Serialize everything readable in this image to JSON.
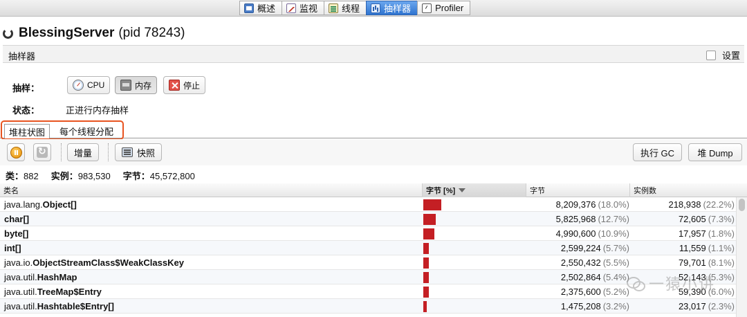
{
  "top_tabs": [
    {
      "label": "概述",
      "icon": "overview-icon",
      "active": false
    },
    {
      "label": "监视",
      "icon": "monitor-icon",
      "active": false
    },
    {
      "label": "线程",
      "icon": "threads-icon",
      "active": false
    },
    {
      "label": "抽样器",
      "icon": "sampler-icon",
      "active": true
    },
    {
      "label": "Profiler",
      "icon": "profiler-icon",
      "active": false
    }
  ],
  "header": {
    "app_name": "BlessingServer",
    "pid": "(pid 78243)"
  },
  "section": {
    "title": "抽样器",
    "settings_label": "设置"
  },
  "sampling": {
    "label": "抽样：",
    "buttons": {
      "cpu": "CPU",
      "memory": "内存",
      "stop": "停止"
    },
    "status_label": "状态：",
    "status_value": "正进行内存抽样"
  },
  "sub_tabs": [
    "堆柱状图",
    "每个线程分配"
  ],
  "toolbar": {
    "delta": "增量",
    "snapshot": "快照",
    "gc": "执行 GC",
    "heap_dump": "堆 Dump"
  },
  "summary": {
    "classes_label": "类：",
    "classes_value": "882",
    "instances_label": "实例：",
    "instances_value": "983,530",
    "bytes_label": "字节：",
    "bytes_value": "45,572,800"
  },
  "table": {
    "columns": [
      "类名",
      "字节 [%]",
      "字节",
      "实例数"
    ],
    "rows": [
      {
        "pkg": "java.lang.",
        "cls": "Object[]",
        "bytes": "8,209,376",
        "bytes_pct": "(18.0%)",
        "inst": "218,938",
        "inst_pct": "(22.2%)",
        "fraction": 0.18
      },
      {
        "pkg": "",
        "cls": "char[]",
        "bytes": "5,825,968",
        "bytes_pct": "(12.7%)",
        "inst": "72,605",
        "inst_pct": "(7.3%)",
        "fraction": 0.127
      },
      {
        "pkg": "",
        "cls": "byte[]",
        "bytes": "4,990,600",
        "bytes_pct": "(10.9%)",
        "inst": "17,957",
        "inst_pct": "(1.8%)",
        "fraction": 0.109
      },
      {
        "pkg": "",
        "cls": "int[]",
        "bytes": "2,599,224",
        "bytes_pct": "(5.7%)",
        "inst": "11,559",
        "inst_pct": "(1.1%)",
        "fraction": 0.057
      },
      {
        "pkg": "java.io.",
        "cls": "ObjectStreamClass$WeakClassKey",
        "bytes": "2,550,432",
        "bytes_pct": "(5.5%)",
        "inst": "79,701",
        "inst_pct": "(8.1%)",
        "fraction": 0.055
      },
      {
        "pkg": "java.util.",
        "cls": "HashMap",
        "bytes": "2,502,864",
        "bytes_pct": "(5.4%)",
        "inst": "52,143",
        "inst_pct": "(5.3%)",
        "fraction": 0.054
      },
      {
        "pkg": "java.util.",
        "cls": "TreeMap$Entry",
        "bytes": "2,375,600",
        "bytes_pct": "(5.2%)",
        "inst": "59,390",
        "inst_pct": "(6.0%)",
        "fraction": 0.052
      },
      {
        "pkg": "java.util.",
        "cls": "Hashtable$Entry[]",
        "bytes": "1,475,208",
        "bytes_pct": "(3.2%)",
        "inst": "23,017",
        "inst_pct": "(2.3%)",
        "fraction": 0.032
      }
    ]
  },
  "watermark": "一猿小讲"
}
